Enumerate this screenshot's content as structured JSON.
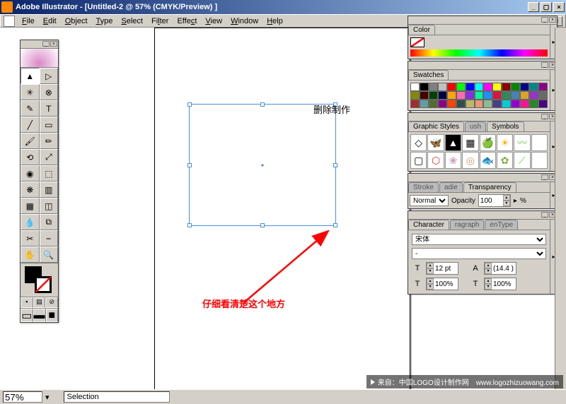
{
  "title": "Adobe Illustrator - [Untitled-2 @ 57% (CMYK/Preview) ]",
  "menus": [
    "File",
    "Edit",
    "Object",
    "Type",
    "Select",
    "Filter",
    "Effect",
    "View",
    "Window",
    "Help"
  ],
  "menu_accel": [
    "F",
    "E",
    "O",
    "T",
    "S",
    "l",
    "c",
    "V",
    "W",
    "H"
  ],
  "annotations": {
    "a1": "删除制作",
    "a2": "仔细看清楚这个地方"
  },
  "status": {
    "zoom": "57%",
    "mode": "Selection"
  },
  "panels": {
    "color": {
      "tab": "Color"
    },
    "swatches": {
      "tab": "Swatches",
      "colors": [
        "#fff",
        "#000",
        "#808080",
        "#c0c0c0",
        "#f00",
        "#0f0",
        "#00f",
        "#0ff",
        "#f0f",
        "#ff0",
        "#800",
        "#080",
        "#008",
        "#088",
        "#808",
        "#880",
        "#400",
        "#040",
        "#004",
        "#ffa500",
        "#ff69b4",
        "#8a2be2",
        "#00fa9a",
        "#1e90ff",
        "#dc143c",
        "#2e8b57",
        "#4682b4",
        "#daa520",
        "#9932cc",
        "#696969",
        "#a52a2a",
        "#5f9ea0",
        "#556b2f",
        "#8b008b",
        "#ff4500",
        "#2f4f4f",
        "#bdb76b",
        "#e9967a",
        "#8fbc8f",
        "#483d8b",
        "#00ced1",
        "#9400d3",
        "#ff1493",
        "#228b22",
        "#4b0082"
      ]
    },
    "styles": {
      "tab1": "Graphic Styles",
      "tab2": "ush",
      "tab3": "Symbols"
    },
    "transparency": {
      "tab1": "Stroke",
      "tab2": "adie",
      "tab3": "Transparency",
      "mode": "Normal",
      "opacity_label": "Opacity",
      "opacity": "100",
      "pct": "%"
    },
    "character": {
      "tab1": "Character",
      "tab2": "ragraph",
      "tab3": "enType",
      "font": "宋体",
      "style": "-",
      "size": "12 pt",
      "leading": "(14.4 )",
      "hscale": "100%",
      "vscale": "100%"
    }
  },
  "watermark": "来自：中国LOGO设计制作网　www.logozhizuowang.com"
}
